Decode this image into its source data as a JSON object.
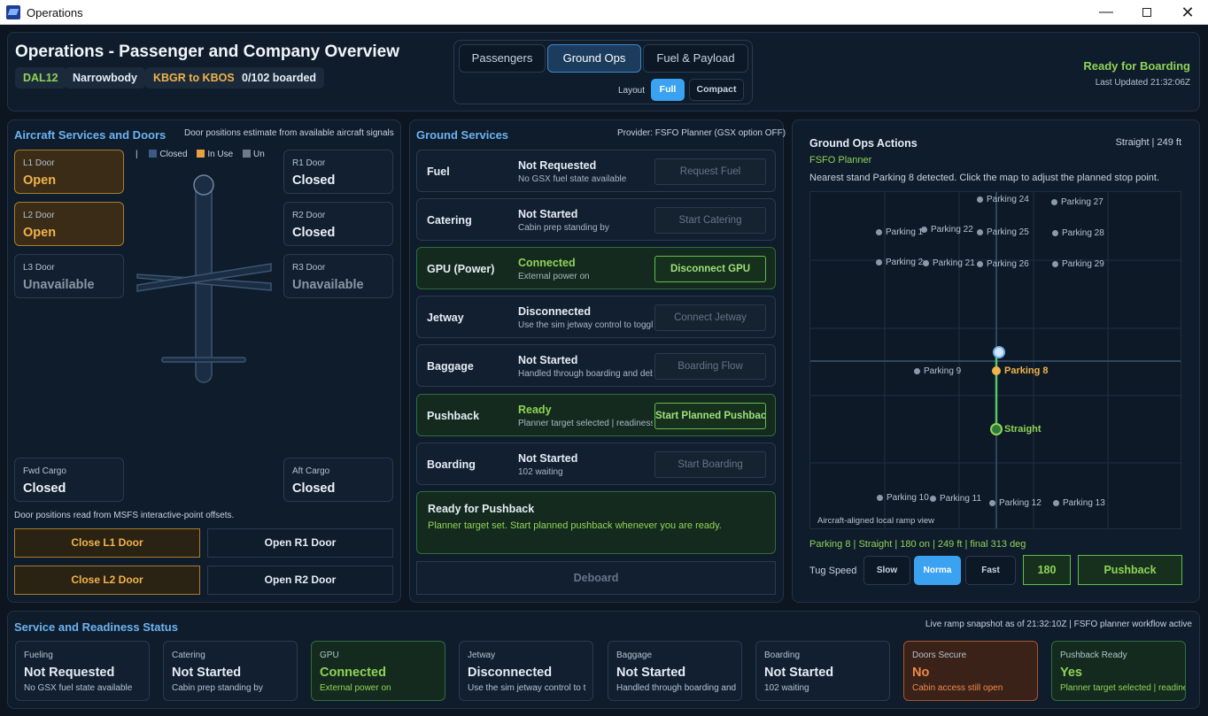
{
  "window": {
    "title": "Operations"
  },
  "header": {
    "title": "Operations - Passenger and Company Overview",
    "pills": [
      "DAL12",
      "Narrowbody",
      "KBGR to KBOS",
      "0/102 boarded"
    ],
    "tabs": [
      "Passengers",
      "Ground Ops",
      "Fuel & Payload"
    ],
    "layout_label": "Layout",
    "layout_options": [
      "Full",
      "Compact"
    ],
    "status": "Ready for Boarding",
    "last_updated": "Last Updated 21:32:06Z"
  },
  "doors_panel": {
    "title": "Aircraft Services and Doors",
    "note": "Door positions estimate from available aircraft signals",
    "legend": [
      "Closed",
      "In Use",
      "Un"
    ],
    "doors": {
      "l1": {
        "label": "L1 Door",
        "value": "Open"
      },
      "l2": {
        "label": "L2 Door",
        "value": "Open"
      },
      "l3": {
        "label": "L3 Door",
        "value": "Unavailable"
      },
      "r1": {
        "label": "R1 Door",
        "value": "Closed"
      },
      "r2": {
        "label": "R2 Door",
        "value": "Closed"
      },
      "r3": {
        "label": "R3 Door",
        "value": "Unavailable"
      },
      "fwd": {
        "label": "Fwd Cargo",
        "value": "Closed"
      },
      "aft": {
        "label": "Aft Cargo",
        "value": "Closed"
      }
    },
    "footnote": "Door positions read from MSFS interactive-point offsets.",
    "buttons": [
      "Close L1 Door",
      "Open R1 Door",
      "Close L2 Door",
      "Open R2 Door"
    ]
  },
  "ground_services": {
    "title": "Ground Services",
    "provider": "Provider: FSFO Planner (GSX option OFF)",
    "rows": [
      {
        "name": "Fuel",
        "status": "Not Requested",
        "sub": "No GSX fuel state available",
        "button": "Request Fuel"
      },
      {
        "name": "Catering",
        "status": "Not Started",
        "sub": "Cabin prep standing by",
        "button": "Start Catering"
      },
      {
        "name": "GPU (Power)",
        "status": "Connected",
        "sub": "External power on",
        "button": "Disconnect GPU"
      },
      {
        "name": "Jetway",
        "status": "Disconnected",
        "sub": "Use the sim jetway control to toggle",
        "button": "Connect Jetway"
      },
      {
        "name": "Baggage",
        "status": "Not Started",
        "sub": "Handled through boarding and deboarding",
        "button": "Boarding Flow"
      },
      {
        "name": "Pushback",
        "status": "Ready",
        "sub": "Planner target selected | readiness",
        "button": "Start Planned Pushback"
      },
      {
        "name": "Boarding",
        "status": "Not Started",
        "sub": "102 waiting",
        "button": "Start Boarding"
      }
    ],
    "banner_title": "Ready for Pushback",
    "banner_text": "Planner target set. Start planned pushback whenever you are ready.",
    "deboard": "Deboard"
  },
  "ground_ops": {
    "title": "Ground Ops Actions",
    "mode": "Straight | 249 ft",
    "planner": "FSFO Planner",
    "instruction": "Nearest stand Parking 8 detected. Click the map to adjust the planned stop point.",
    "stands": [
      "Parking 24",
      "Parking 27",
      "Parking 1",
      "Parking 22",
      "Parking 25",
      "Parking 28",
      "Parking 20",
      "Parking 21",
      "Parking 26",
      "Parking 29",
      "Parking 9",
      "Parking 10",
      "Parking 11",
      "Parking 12",
      "Parking 13"
    ],
    "current_stand": "Parking 8",
    "target_label": "Straight",
    "map_caption": "Aircraft-aligned local ramp view",
    "summary": "Parking 8 | Straight | 180 on | 249 ft | final 313 deg",
    "tug_label": "Tug Speed",
    "tug_speeds": [
      "Slow",
      "Norma",
      "Fast"
    ],
    "heading_value": "180",
    "pushback_button": "Pushback"
  },
  "readiness": {
    "title": "Service and Readiness Status",
    "snapshot": "Live ramp snapshot as of 21:32:10Z | FSFO planner workflow active",
    "cards": [
      {
        "label": "Fueling",
        "value": "Not Requested",
        "sub": "No GSX fuel state available"
      },
      {
        "label": "Catering",
        "value": "Not Started",
        "sub": "Cabin prep standing by"
      },
      {
        "label": "GPU",
        "value": "Connected",
        "sub": "External power on"
      },
      {
        "label": "Jetway",
        "value": "Disconnected",
        "sub": "Use the sim jetway control to t"
      },
      {
        "label": "Baggage",
        "value": "Not Started",
        "sub": "Handled through boarding and"
      },
      {
        "label": "Boarding",
        "value": "Not Started",
        "sub": "102 waiting"
      },
      {
        "label": "Doors Secure",
        "value": "No",
        "sub": "Cabin access still open"
      },
      {
        "label": "Pushback Ready",
        "value": "Yes",
        "sub": "Planner target selected | readine"
      }
    ]
  },
  "colors": {
    "accent": "#3aa2f0",
    "ready": "#8fd457",
    "amber": "#f2b34a",
    "warn": "#f08a4b"
  }
}
